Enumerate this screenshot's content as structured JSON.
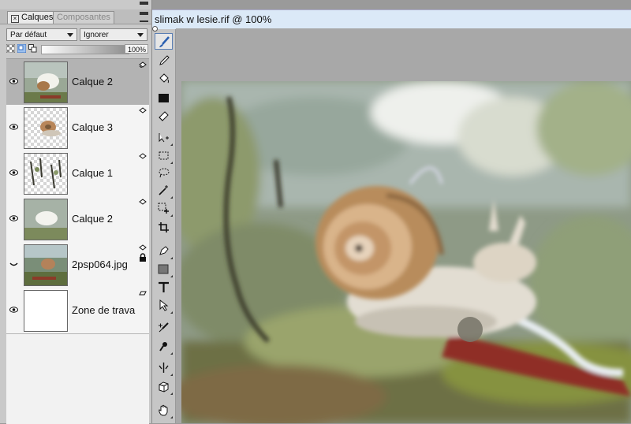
{
  "panel": {
    "tabs": [
      {
        "label": "Calques",
        "active": true
      },
      {
        "label": "Composantes",
        "active": false
      }
    ],
    "blend_mode": "Par défaut",
    "lock_mode": "Ignorer",
    "opacity": "100%"
  },
  "layers": [
    {
      "name": "Calque 2",
      "selected": true,
      "visible": true
    },
    {
      "name": "Calque 3",
      "selected": false,
      "visible": true
    },
    {
      "name": "Calque 1",
      "selected": false,
      "visible": true
    },
    {
      "name": "Calque 2",
      "selected": false,
      "visible": true
    },
    {
      "name": "2psp064.jpg",
      "selected": false,
      "visible": false,
      "locked": true
    },
    {
      "name": "Zone de trava",
      "selected": false,
      "visible": true
    }
  ],
  "document": {
    "title": "slimak w lesie.rif @ 100%"
  },
  "tools": [
    "brush",
    "dropper",
    "paint-bucket",
    "eraser-block",
    "eraser",
    "layer-adjuster",
    "rect-select",
    "lasso",
    "magic-wand",
    "transform",
    "crop",
    "pen",
    "shape",
    "text",
    "selector",
    "cloner",
    "rubber-stamp",
    "mirror",
    "divine-proportion",
    "grabber"
  ],
  "colors": {
    "title_bar": "#dbe9f7",
    "selected_row": "#b3b3b3",
    "active_tool_border": "#5b7fb3"
  }
}
